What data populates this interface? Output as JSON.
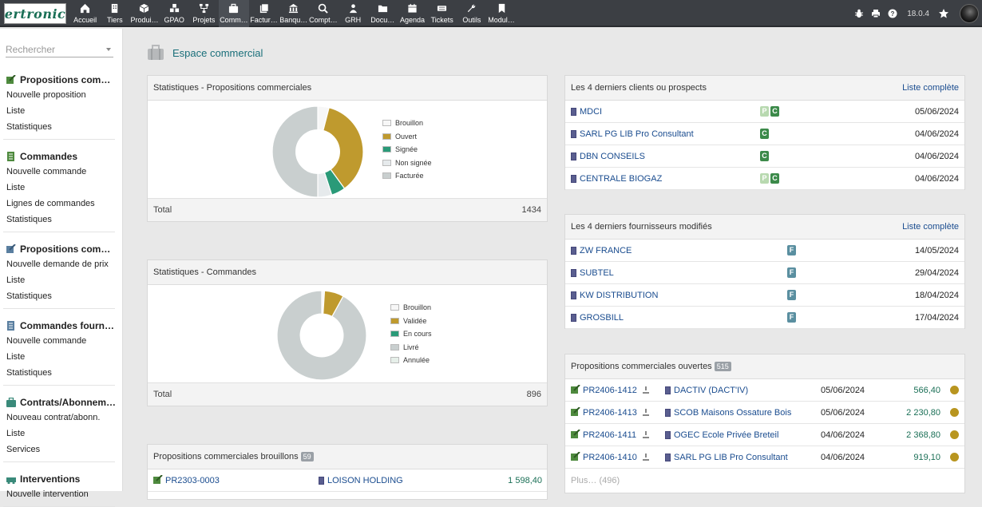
{
  "app": {
    "logo_text": "ertronic",
    "version": "18.0.4"
  },
  "menu": [
    {
      "label": "Accueil",
      "icon": "home-icon"
    },
    {
      "label": "Tiers",
      "icon": "building-icon"
    },
    {
      "label": "Produi…",
      "icon": "cube-icon"
    },
    {
      "label": "GPAO",
      "icon": "cubes-icon"
    },
    {
      "label": "Projets",
      "icon": "sitemap-icon"
    },
    {
      "label": "Comm…",
      "icon": "suitcase-icon",
      "active": true
    },
    {
      "label": "Factur…",
      "icon": "invoice-icon"
    },
    {
      "label": "Banqu…",
      "icon": "bank-icon"
    },
    {
      "label": "Compt…",
      "icon": "search-dollar-icon"
    },
    {
      "label": "GRH",
      "icon": "users-icon"
    },
    {
      "label": "Docu…",
      "icon": "folder-icon"
    },
    {
      "label": "Agenda",
      "icon": "calendar-icon"
    },
    {
      "label": "Tickets",
      "icon": "ticket-icon"
    },
    {
      "label": "Outils",
      "icon": "wrench-icon"
    },
    {
      "label": "Modul…",
      "icon": "module-icon"
    }
  ],
  "sidebar": {
    "search_placeholder": "Rechercher",
    "groups": [
      {
        "title": "Propositions comm…",
        "icon": "proposal-icon",
        "links": [
          "Nouvelle proposition",
          "Liste",
          "Statistiques"
        ]
      },
      {
        "title": "Commandes",
        "icon": "order-icon",
        "links": [
          "Nouvelle commande",
          "Liste",
          "Lignes de commandes",
          "Statistiques"
        ]
      },
      {
        "title": "Propositions comm…",
        "icon": "supplier-proposal-icon",
        "links": [
          "Nouvelle demande de prix",
          "Liste",
          "Statistiques"
        ]
      },
      {
        "title": "Commandes fournis…",
        "icon": "supplier-order-icon",
        "links": [
          "Nouvelle commande",
          "Liste",
          "Statistiques"
        ]
      },
      {
        "title": "Contrats/Abonneme…",
        "icon": "contract-icon",
        "links": [
          "Nouveau contrat/abonn.",
          "Liste",
          "Services"
        ]
      },
      {
        "title": "Interventions",
        "icon": "intervention-icon",
        "links": [
          "Nouvelle intervention"
        ]
      }
    ]
  },
  "page": {
    "title": "Espace commercial"
  },
  "stats_proposals": {
    "title": "Statistiques - Propositions commerciales",
    "total_label": "Total",
    "total": "1434",
    "chart_data": {
      "type": "pie",
      "donut": true,
      "labels": [
        "Brouillon",
        "Ouvert",
        "Signée",
        "Non signée",
        "Facturée"
      ],
      "values": [
        4,
        36,
        5,
        5,
        50
      ],
      "colors": [
        "#f7f7f7",
        "#bf9a2e",
        "#2a9a78",
        "#e6eaec",
        "#c9cfcf"
      ]
    }
  },
  "stats_orders": {
    "title": "Statistiques - Commandes",
    "total_label": "Total",
    "total": "896",
    "chart_data": {
      "type": "pie",
      "donut": true,
      "labels": [
        "Brouillon",
        "Validée",
        "En cours",
        "Livré",
        "Annulée"
      ],
      "values": [
        1,
        7,
        0,
        92,
        0
      ],
      "colors": [
        "#f7f7f7",
        "#bf9a2e",
        "#2a9a78",
        "#c9cfcf",
        "#e6efe9"
      ]
    }
  },
  "draft_proposals": {
    "title": "Propositions commerciales brouillons",
    "count": "59",
    "rows": [
      {
        "ref": "PR2303-0003",
        "company": "LOISON HOLDING",
        "amount": "1 598,40"
      }
    ]
  },
  "last_clients": {
    "title": "Les 4 derniers clients ou prospects",
    "link": "Liste complète",
    "rows": [
      {
        "name": "MDCI",
        "prospect": true,
        "client": true,
        "date": "05/06/2024"
      },
      {
        "name": "SARL PG LIB Pro Consultant",
        "prospect": false,
        "client": true,
        "date": "04/06/2024"
      },
      {
        "name": "DBN CONSEILS",
        "prospect": false,
        "client": true,
        "date": "04/06/2024"
      },
      {
        "name": "CENTRALE BIOGAZ",
        "prospect": true,
        "client": true,
        "date": "04/06/2024"
      }
    ],
    "tag_p": "P",
    "tag_c": "C"
  },
  "last_suppliers": {
    "title": "Les 4 derniers fournisseurs modifiés",
    "link": "Liste complète",
    "tag_f": "F",
    "rows": [
      {
        "name": "ZW FRANCE",
        "date": "14/05/2024"
      },
      {
        "name": "SUBTEL",
        "date": "29/04/2024"
      },
      {
        "name": "KW DISTRIBUTION",
        "date": "18/04/2024"
      },
      {
        "name": "GROSBILL",
        "date": "17/04/2024"
      }
    ]
  },
  "open_proposals": {
    "title": "Propositions commerciales ouvertes",
    "count": "515",
    "rows": [
      {
        "ref": "PR2406-1412",
        "company": "DACTIV (DACT'IV)",
        "date": "05/06/2024",
        "amount": "566,40"
      },
      {
        "ref": "PR2406-1413",
        "company": "SCOB Maisons Ossature Bois",
        "date": "05/06/2024",
        "amount": "2 230,80"
      },
      {
        "ref": "PR2406-1411",
        "company": "OGEC Ecole Privée Breteil",
        "date": "04/06/2024",
        "amount": "2 368,80"
      },
      {
        "ref": "PR2406-1410",
        "company": "SARL PG LIB Pro Consultant",
        "date": "04/06/2024",
        "amount": "919,10"
      }
    ],
    "more": "Plus… (496)"
  }
}
